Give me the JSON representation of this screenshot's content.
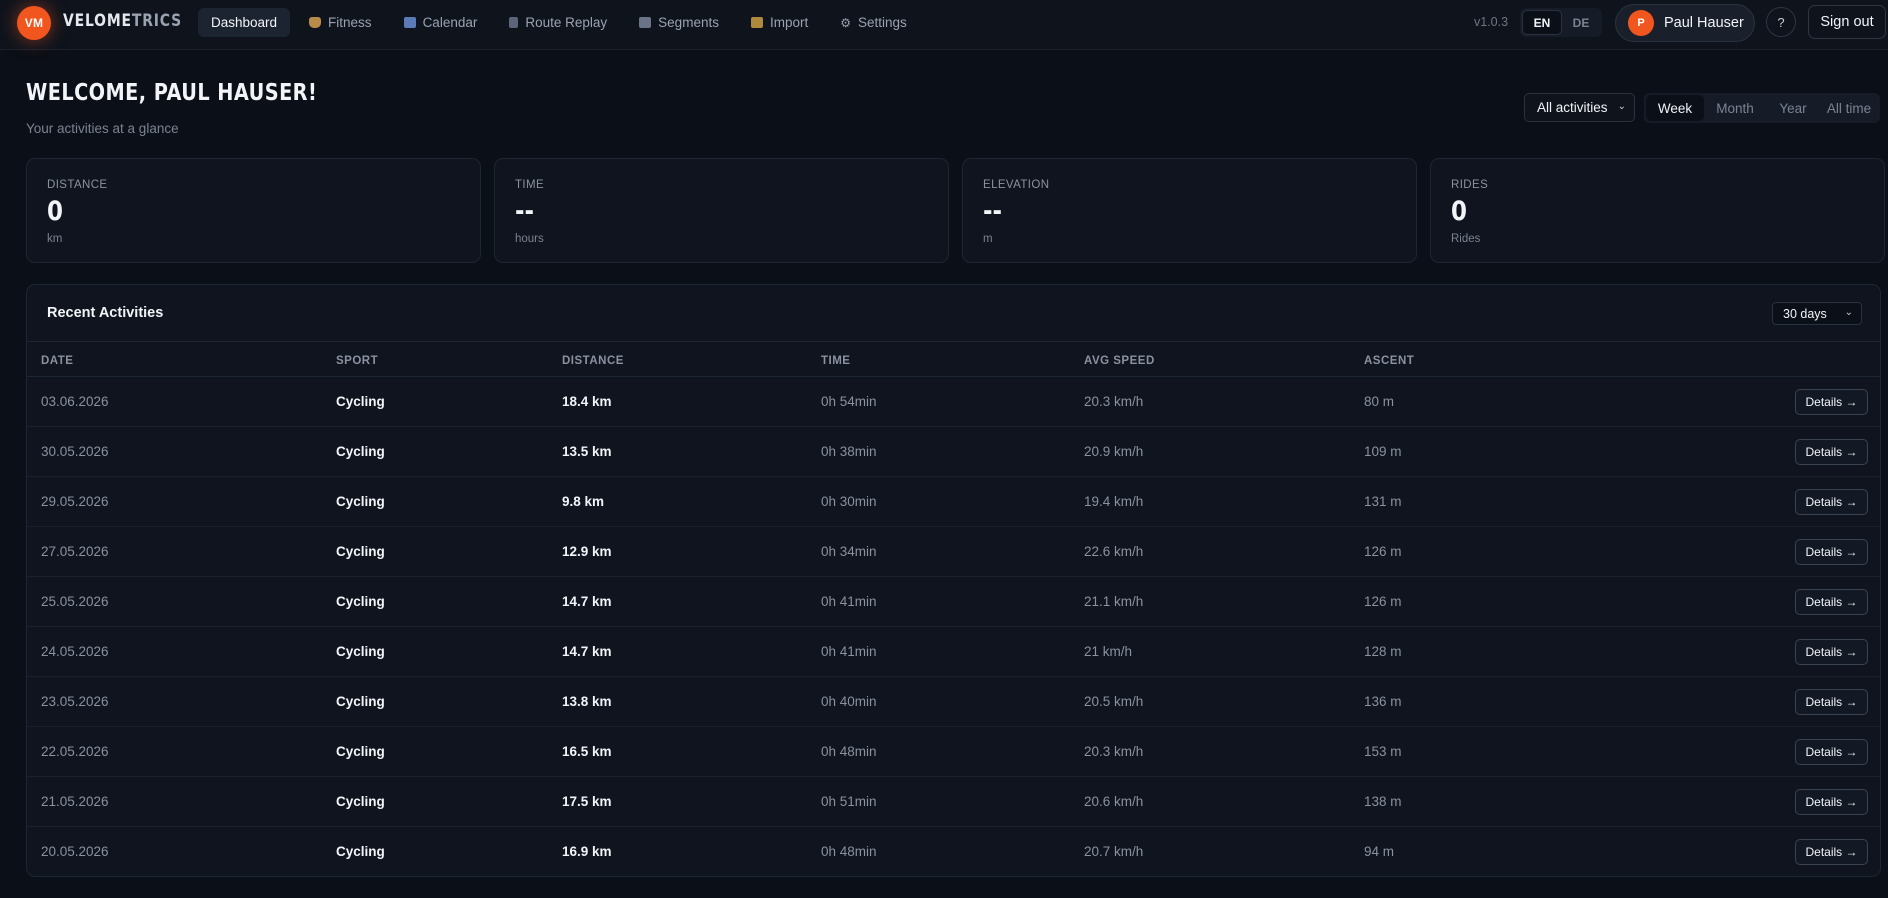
{
  "app": {
    "logo_badge": "VM",
    "logo_main": "VELOME",
    "logo_accent": "TRICS",
    "version": "v1.0.3",
    "accent_color": "#f2561f"
  },
  "nav": {
    "items": [
      {
        "label": "Dashboard",
        "icon": "none",
        "active": true
      },
      {
        "label": "Fitness",
        "icon": "flexed-arm-icon"
      },
      {
        "label": "Calendar",
        "icon": "calendar-icon"
      },
      {
        "label": "Route Replay",
        "icon": "route-icon"
      },
      {
        "label": "Segments",
        "icon": "chart-icon"
      },
      {
        "label": "Import",
        "icon": "folder-icon"
      },
      {
        "label": "Settings",
        "icon": "gear-icon"
      }
    ]
  },
  "lang": {
    "en": "EN",
    "de": "DE",
    "active": "EN"
  },
  "user": {
    "initial": "P",
    "name": "Paul Hauser"
  },
  "help_label": "?",
  "signout_label": "Sign out",
  "header": {
    "welcome": "WELCOME, PAUL HAUSER!",
    "subtitle": "Your activities at a glance",
    "activity_filter": "All activities",
    "periods": [
      "Week",
      "Month",
      "Year",
      "All time"
    ],
    "active_period": "Week"
  },
  "stats": [
    {
      "label": "DISTANCE",
      "value": "0",
      "unit": "km"
    },
    {
      "label": "TIME",
      "value": "--",
      "unit": "hours"
    },
    {
      "label": "ELEVATION",
      "value": "--",
      "unit": "m"
    },
    {
      "label": "RIDES",
      "value": "0",
      "unit": "Rides"
    }
  ],
  "recent": {
    "title": "Recent Activities",
    "range": "30 days",
    "columns": [
      "DATE",
      "SPORT",
      "DISTANCE",
      "TIME",
      "AVG SPEED",
      "ASCENT"
    ],
    "details_label": "Details →",
    "rows": [
      {
        "date": "03.06.2026",
        "sport": "Cycling",
        "distance": "18.4 km",
        "time": "0h 54min",
        "speed": "20.3 km/h",
        "ascent": "80 m"
      },
      {
        "date": "30.05.2026",
        "sport": "Cycling",
        "distance": "13.5 km",
        "time": "0h 38min",
        "speed": "20.9 km/h",
        "ascent": "109 m"
      },
      {
        "date": "29.05.2026",
        "sport": "Cycling",
        "distance": "9.8 km",
        "time": "0h 30min",
        "speed": "19.4 km/h",
        "ascent": "131 m"
      },
      {
        "date": "27.05.2026",
        "sport": "Cycling",
        "distance": "12.9 km",
        "time": "0h 34min",
        "speed": "22.6 km/h",
        "ascent": "126 m"
      },
      {
        "date": "25.05.2026",
        "sport": "Cycling",
        "distance": "14.7 km",
        "time": "0h 41min",
        "speed": "21.1 km/h",
        "ascent": "126 m"
      },
      {
        "date": "24.05.2026",
        "sport": "Cycling",
        "distance": "14.7 km",
        "time": "0h 41min",
        "speed": "21 km/h",
        "ascent": "128 m"
      },
      {
        "date": "23.05.2026",
        "sport": "Cycling",
        "distance": "13.8 km",
        "time": "0h 40min",
        "speed": "20.5 km/h",
        "ascent": "136 m"
      },
      {
        "date": "22.05.2026",
        "sport": "Cycling",
        "distance": "16.5 km",
        "time": "0h 48min",
        "speed": "20.3 km/h",
        "ascent": "153 m"
      },
      {
        "date": "21.05.2026",
        "sport": "Cycling",
        "distance": "17.5 km",
        "time": "0h 51min",
        "speed": "20.6 km/h",
        "ascent": "138 m"
      },
      {
        "date": "20.05.2026",
        "sport": "Cycling",
        "distance": "16.9 km",
        "time": "0h 48min",
        "speed": "20.7 km/h",
        "ascent": "94 m"
      }
    ]
  }
}
